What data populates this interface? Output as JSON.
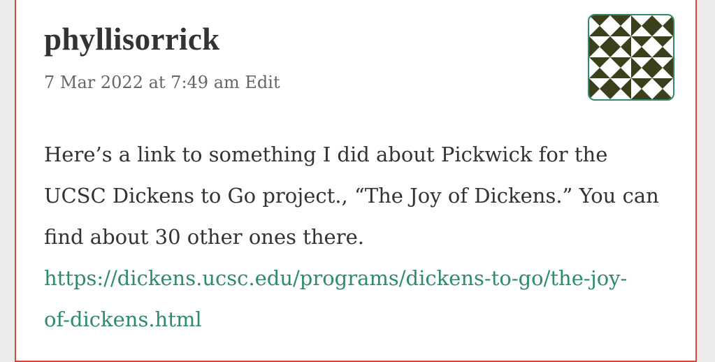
{
  "comment": {
    "author": "phyllisorrick",
    "timestamp": "7 Mar 2022 at 7:49 am",
    "edit_label": "Edit",
    "text_line1": "Here’s a link to something I did about Pickwick for the",
    "text_line2": "UCSC Dickens to Go project., “The Joy of Dickens.” You can",
    "text_line3": "find about 30 other ones there.",
    "link_part1": "https://dickens.ucsc.edu/programs/dickens-to-go/the-joy-",
    "link_part2": "of-dickens.html"
  },
  "colors": {
    "card_border": "#d9483f",
    "link": "#2e8b6e",
    "avatar_pattern": "#3b3f1b",
    "avatar_border": "#2e8b6e"
  },
  "icons": {
    "avatar": "identicon-avatar"
  }
}
